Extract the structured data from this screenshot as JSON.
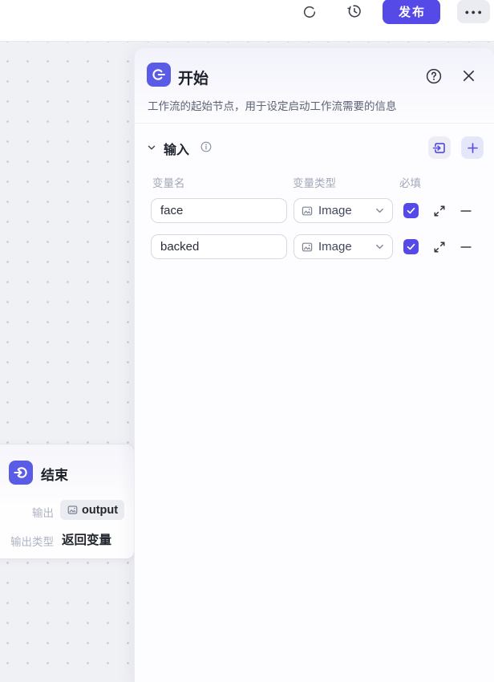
{
  "topbar": {
    "publish_label": "发布",
    "more_label": "●●●"
  },
  "panel": {
    "title": "开始",
    "description": "工作流的起始节点，用于设定启动工作流需要的信息",
    "input_section": {
      "label": "输入"
    },
    "table": {
      "col_name": "变量名",
      "col_type": "变量类型",
      "col_required": "必填",
      "rows": [
        {
          "name": "face",
          "type": "Image",
          "required": true
        },
        {
          "name": "backed",
          "type": "Image",
          "required": true
        }
      ]
    }
  },
  "end_node": {
    "title": "结束",
    "output_label": "输出",
    "output_value": "output",
    "output_type_label": "输出类型",
    "output_type_value": "返回变量"
  },
  "colors": {
    "accent": "#5549e8",
    "icon_tile": "#5b5ce6",
    "soft_button_bg": "#e9eafa",
    "canvas_bg": "#f0f1f5",
    "dot": "#c7c8d2"
  }
}
